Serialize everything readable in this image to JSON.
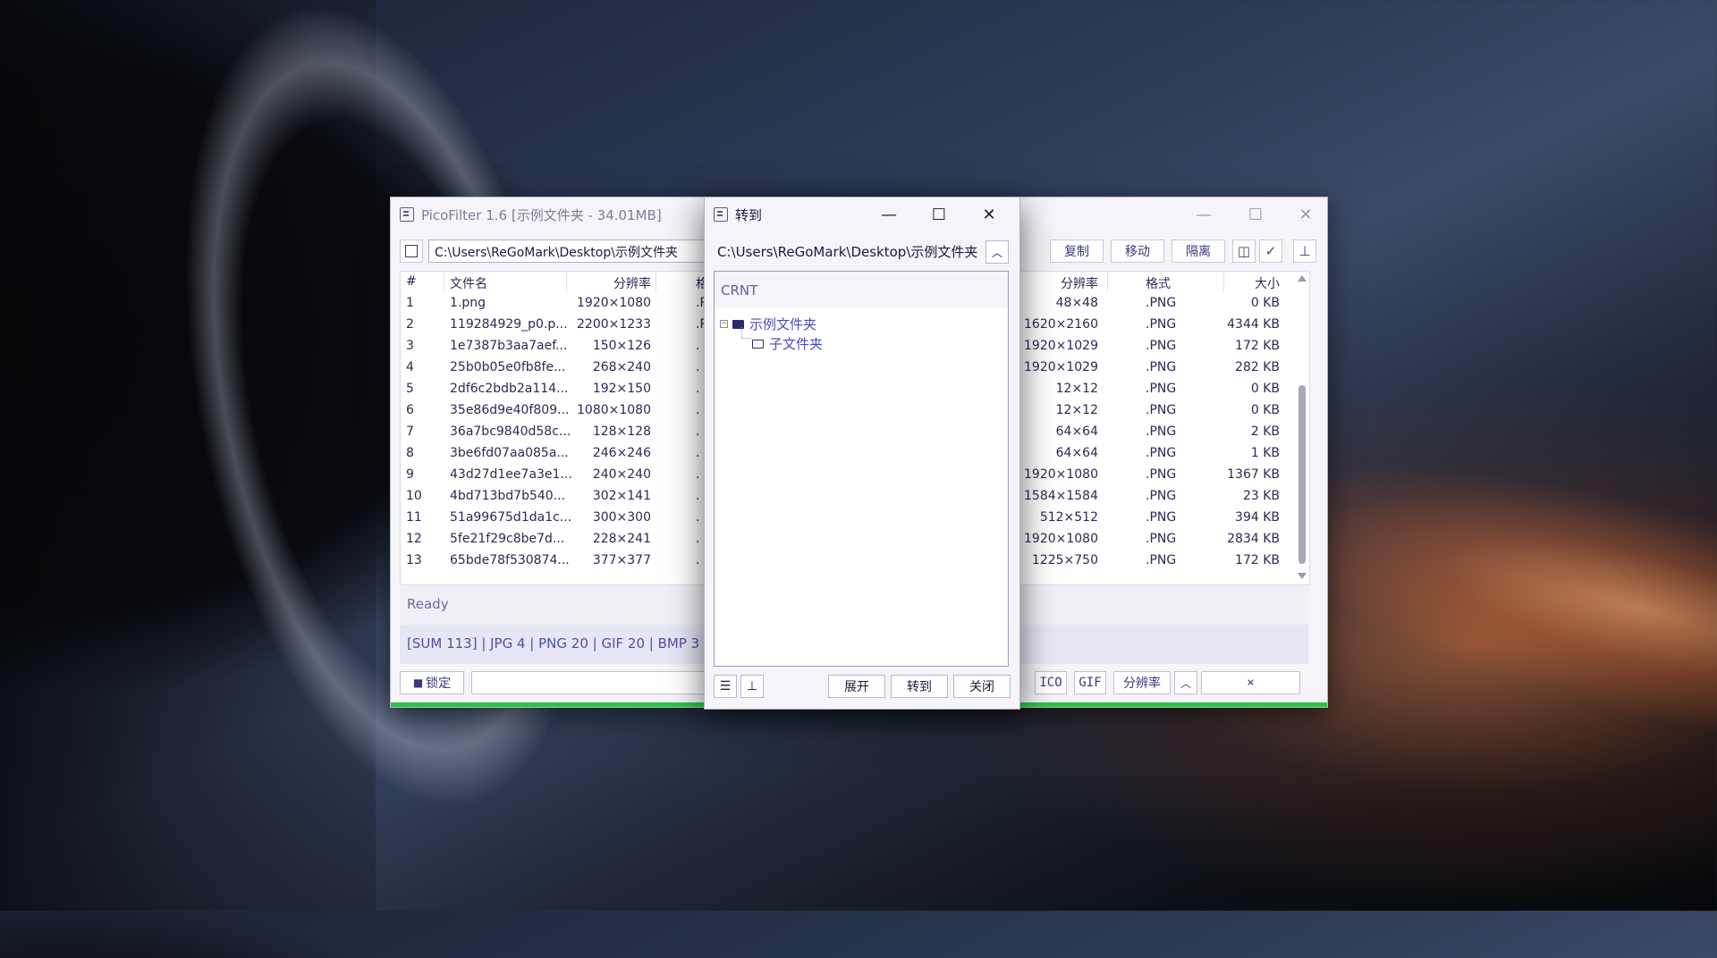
{
  "main_window": {
    "title": "PicoFilter 1.6  [示例文件夹 - 34.01MB]",
    "path": "C:\\Users\\ReGoMark\\Desktop\\示例文件夹",
    "toolbar": {
      "copy_label": "复制",
      "move_label": "移动",
      "isolate_label": "隔离"
    },
    "columns": {
      "index": "#",
      "name": "文件名",
      "resolution": "分辨率",
      "format_partial": "格",
      "resolution2": "分辨率",
      "format": "格式",
      "size": "大小"
    },
    "rows": [
      {
        "idx": "1",
        "name": "1.png",
        "res": "1920×1080",
        "fmt_partial": ".P",
        "res2": "48×48",
        "fmt": ".PNG",
        "size": "0 KB"
      },
      {
        "idx": "2",
        "name": "119284929_p0.p...",
        "res": "2200×1233",
        "fmt_partial": ".P",
        "res2": "1620×2160",
        "fmt": ".PNG",
        "size": "4344 KB"
      },
      {
        "idx": "3",
        "name": "1e7387b3aa7aef...",
        "res": "150×126",
        "fmt_partial": ".",
        "res2": "1920×1029",
        "fmt": ".PNG",
        "size": "172 KB"
      },
      {
        "idx": "4",
        "name": "25b0b05e0fb8fe...",
        "res": "268×240",
        "fmt_partial": ".",
        "res2": "1920×1029",
        "fmt": ".PNG",
        "size": "282 KB"
      },
      {
        "idx": "5",
        "name": "2df6c2bdb2a114...",
        "res": "192×150",
        "fmt_partial": ".",
        "res2": "12×12",
        "fmt": ".PNG",
        "size": "0 KB"
      },
      {
        "idx": "6",
        "name": "35e86d9e40f809...",
        "res": "1080×1080",
        "fmt_partial": ".",
        "res2": "12×12",
        "fmt": ".PNG",
        "size": "0 KB"
      },
      {
        "idx": "7",
        "name": "36a7bc9840d58c...",
        "res": "128×128",
        "fmt_partial": ".",
        "res2": "64×64",
        "fmt": ".PNG",
        "size": "2 KB"
      },
      {
        "idx": "8",
        "name": "3be6fd07aa085a...",
        "res": "246×246",
        "fmt_partial": ".",
        "res2": "64×64",
        "fmt": ".PNG",
        "size": "1 KB"
      },
      {
        "idx": "9",
        "name": "43d27d1ee7a3e1...",
        "res": "240×240",
        "fmt_partial": ".",
        "res2": "1920×1080",
        "fmt": ".PNG",
        "size": "1367 KB"
      },
      {
        "idx": "10",
        "name": "4bd713bd7b540...",
        "res": "302×141",
        "fmt_partial": ".",
        "res2": "1584×1584",
        "fmt": ".PNG",
        "size": "23 KB"
      },
      {
        "idx": "11",
        "name": "51a99675d1da1c...",
        "res": "300×300",
        "fmt_partial": ".",
        "res2": "512×512",
        "fmt": ".PNG",
        "size": "394 KB"
      },
      {
        "idx": "12",
        "name": "5fe21f29c8be7d...",
        "res": "228×241",
        "fmt_partial": ".",
        "res2": "1920×1080",
        "fmt": ".PNG",
        "size": "2834 KB"
      },
      {
        "idx": "13",
        "name": "65bde78f530874...",
        "res": "377×377",
        "fmt_partial": ".",
        "res2": "1225×750",
        "fmt": ".PNG",
        "size": "172 KB"
      }
    ],
    "status": "Ready",
    "stats": "[SUM 113]  |  JPG 4  |  PNG 20  |  GIF 20  |  BMP 3",
    "bottom": {
      "lock_label": "锁定",
      "ico_label": "ICO",
      "gif_label": "GIF",
      "resolution_label": "分辨率",
      "clear_label": "×"
    },
    "accent_color": "#2ec14a"
  },
  "goto_dialog": {
    "title": "转到",
    "path": "C:\\Users\\ReGoMark\\Desktop\\示例文件夹",
    "crnt_label": "CRNT",
    "tree": {
      "root": "示例文件夹",
      "expander": "−",
      "child": "子文件夹"
    },
    "buttons": {
      "expand": "展开",
      "goto": "转到",
      "close": "关闭"
    }
  }
}
